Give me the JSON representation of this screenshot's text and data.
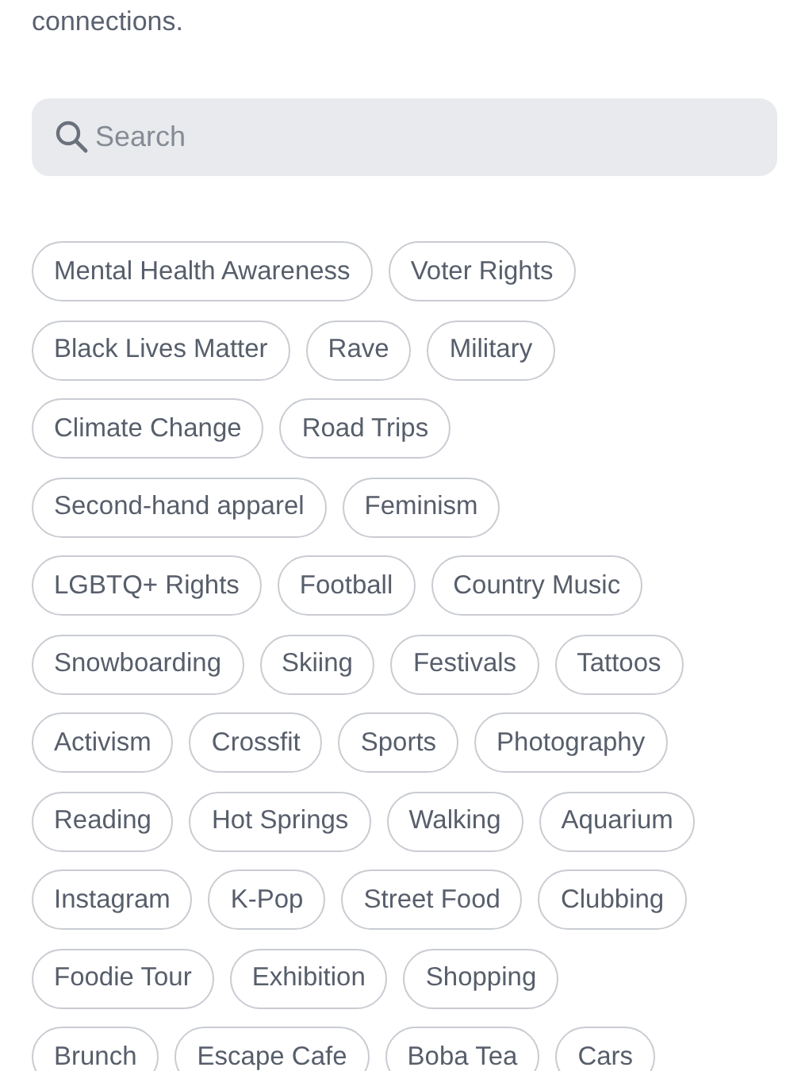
{
  "intro_text": "connections.",
  "search": {
    "placeholder": "Search"
  },
  "tag_rows": [
    [
      "Mental Health Awareness",
      "Voter Rights"
    ],
    [
      "Black Lives Matter",
      "Rave",
      "Military"
    ],
    [
      "Climate Change",
      "Road Trips"
    ],
    [
      "Second-hand apparel",
      "Feminism"
    ],
    [
      "LGBTQ+ Rights",
      "Football",
      "Country Music"
    ],
    [
      "Snowboarding",
      "Skiing",
      "Festivals",
      "Tattoos"
    ],
    [
      "Activism",
      "Crossfit",
      "Sports",
      "Photography"
    ],
    [
      "Reading",
      "Hot Springs",
      "Walking",
      "Aquarium"
    ],
    [
      "Instagram",
      "K-Pop",
      "Street Food",
      "Clubbing"
    ],
    [
      "Foodie Tour",
      "Exhibition",
      "Shopping"
    ],
    [
      "Brunch",
      "Escape Cafe",
      "Boba Tea",
      "Cars"
    ]
  ]
}
